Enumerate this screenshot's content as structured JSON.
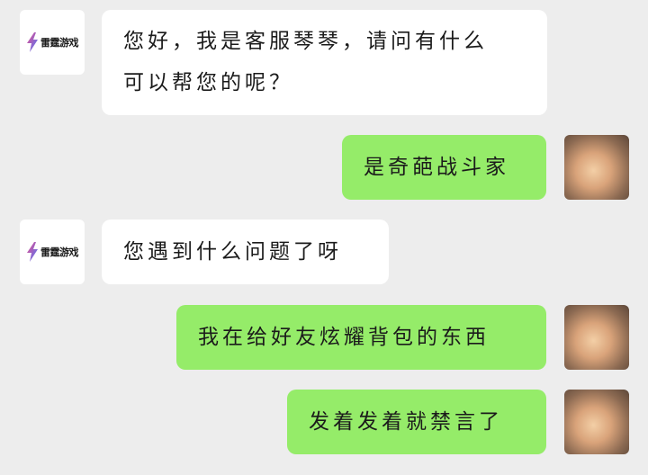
{
  "service": {
    "logo_text": "雷霆游戏",
    "logo_icon": "lightning-bolt-icon"
  },
  "messages": [
    {
      "from": "service",
      "lines": [
        "您好，我是客服琴琴，请问有什么",
        "可以帮您的呢？"
      ]
    },
    {
      "from": "user",
      "lines": [
        "是奇葩战斗家"
      ]
    },
    {
      "from": "service",
      "lines": [
        "您遇到什么问题了呀"
      ]
    },
    {
      "from": "user",
      "lines": [
        "我在给好友炫耀背包的东西"
      ]
    },
    {
      "from": "user",
      "lines": [
        "发着发着就禁言了"
      ]
    }
  ],
  "colors": {
    "background": "#ededed",
    "incoming_bubble": "#ffffff",
    "outgoing_bubble": "#95ec69"
  }
}
